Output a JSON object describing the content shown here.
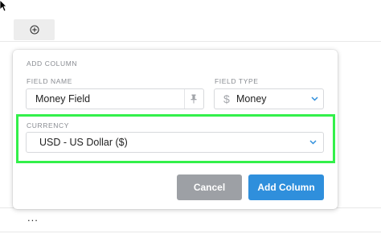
{
  "toolbar": {
    "add_icon": "plus-circle-icon",
    "more_label": "..."
  },
  "panel": {
    "title": "ADD COLUMN",
    "field_name": {
      "label": "FIELD NAME",
      "value": "Money Field",
      "pin_icon": "pin-icon"
    },
    "field_type": {
      "label": "FIELD TYPE",
      "value": "Money",
      "icon": "dollar-sign-icon",
      "dropdown_icon": "chevron-down-icon"
    },
    "currency": {
      "label": "CURRENCY",
      "value": "USD - US Dollar ($)",
      "dropdown_icon": "chevron-down-icon"
    },
    "cancel_label": "Cancel",
    "submit_label": "Add Column"
  },
  "colors": {
    "accent": "#2f8fdc",
    "cancel": "#9da0a5",
    "highlight": "#33f04a",
    "label": "#888b91"
  }
}
